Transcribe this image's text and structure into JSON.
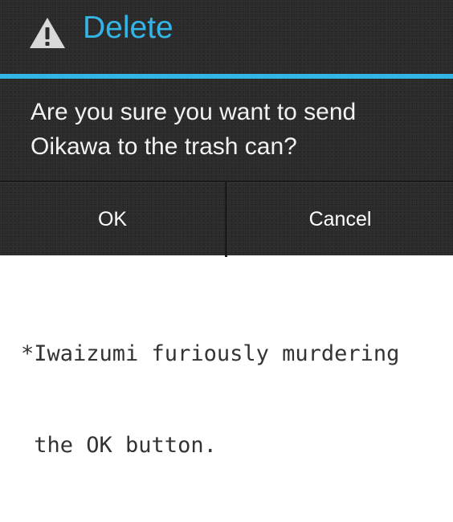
{
  "dialog": {
    "icon": "warning-icon",
    "title": "Delete",
    "message_line1": "Are you sure you want to send",
    "message_line2": "Oikawa to the trash can?",
    "ok_label": "OK",
    "cancel_label": "Cancel"
  },
  "caption": {
    "line1": "*Iwaizumi furiously murdering",
    "line2": " the OK button."
  },
  "colors": {
    "accent": "#33b5e5",
    "dialog_background": "#2b2b2b",
    "text": "#f2f2f2"
  }
}
